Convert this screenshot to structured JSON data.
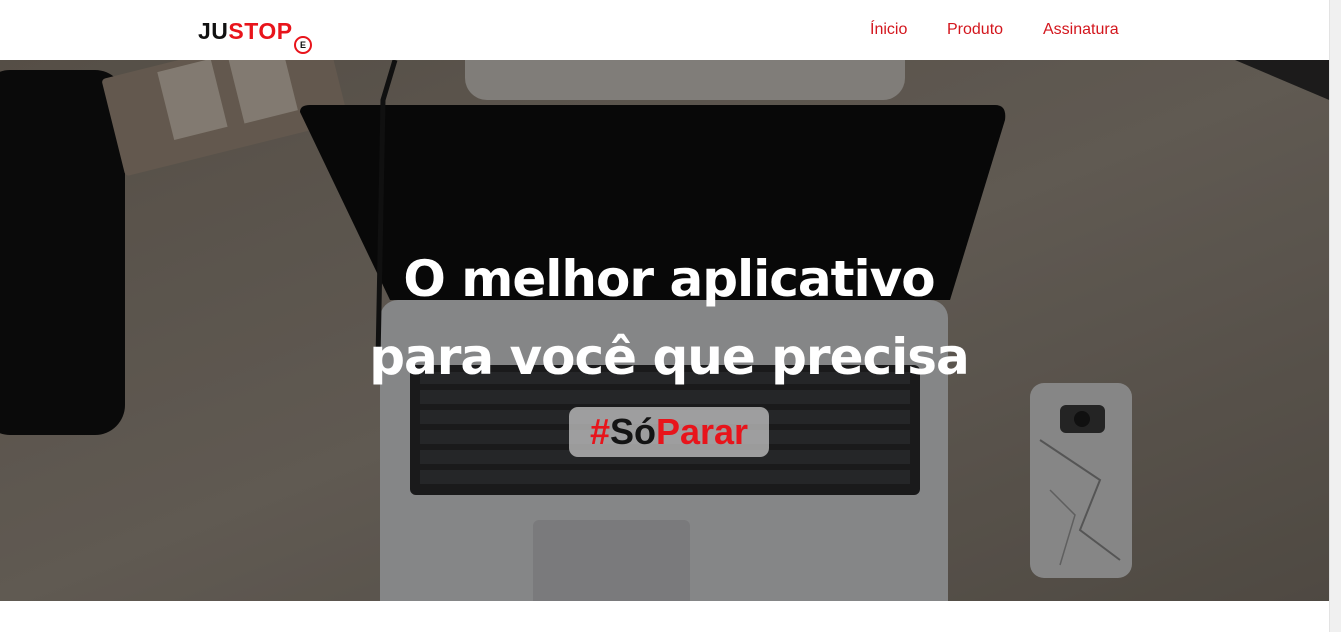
{
  "brand": {
    "logo_part1": "JU",
    "logo_part2": "STOP",
    "logo_badge": "E",
    "colors": {
      "primary": "#e8141b",
      "dark": "#111111",
      "nav_link": "#d3161d"
    }
  },
  "nav": {
    "items": [
      {
        "label": "Ínicio"
      },
      {
        "label": "Produto"
      },
      {
        "label": "Assinatura"
      }
    ]
  },
  "hero": {
    "title_line1": "O melhor aplicativo",
    "title_line2": "para você que precisa",
    "hashtag": {
      "hash": "#",
      "so": "Só",
      "parar": "Parar"
    },
    "background_description_icon": "laptop-desk-photo"
  }
}
